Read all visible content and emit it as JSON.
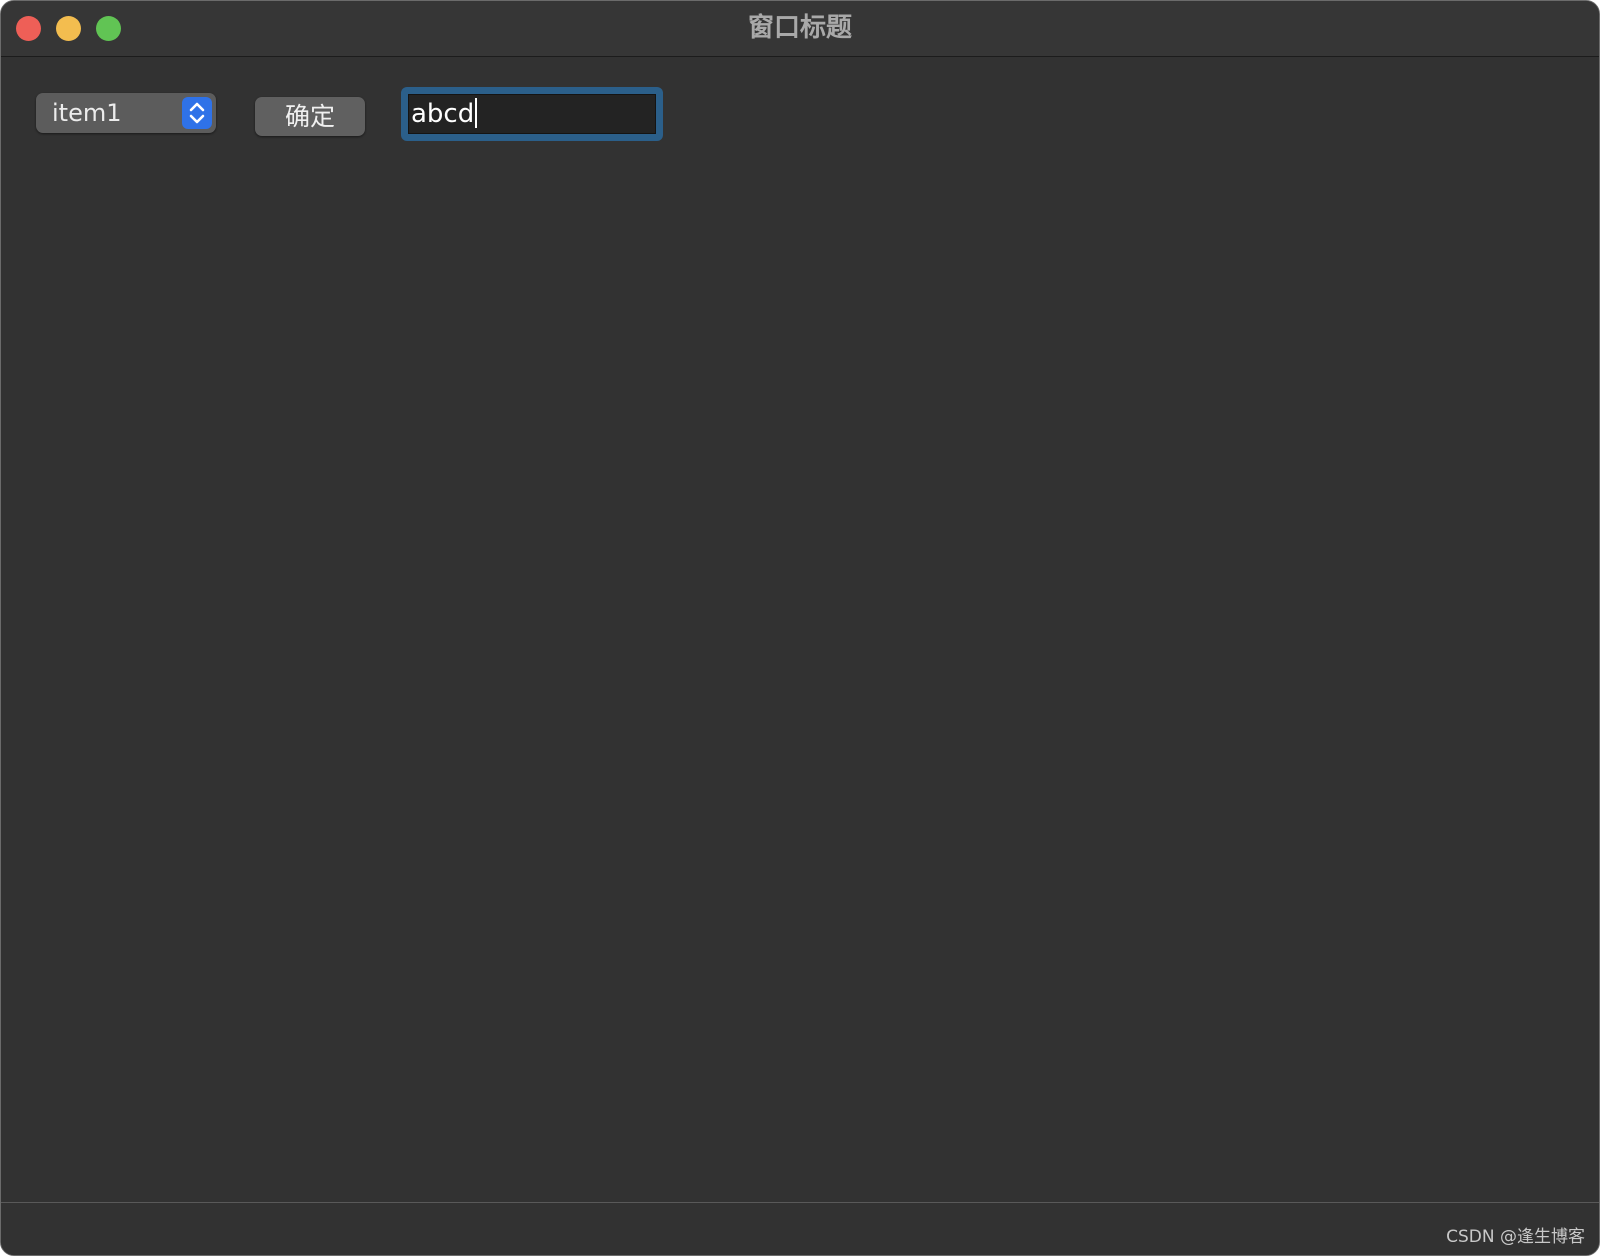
{
  "window": {
    "title": "窗口标题"
  },
  "controls": {
    "popup_selected": "item1",
    "confirm_label": "确定",
    "text_value": "abcd"
  },
  "watermark": "CSDN @逢生博客",
  "colors": {
    "close": "#ee5f57",
    "minimize": "#f3bd4f",
    "maximize": "#61c454",
    "accent": "#2f72e8",
    "focus_ring": "#2b5f8a",
    "background": "#323232"
  },
  "icons": {
    "popup_arrows": "chevron-up-down-icon"
  }
}
